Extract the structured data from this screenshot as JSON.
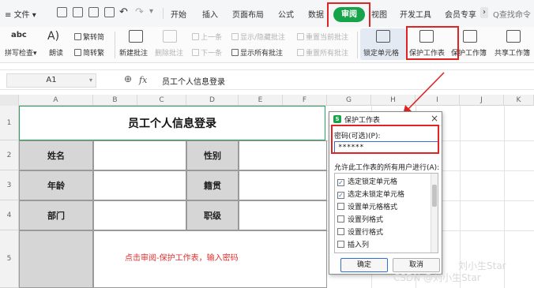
{
  "menu": {
    "file_label": "文件",
    "tabs": [
      "开始",
      "插入",
      "页面布局",
      "公式",
      "数据",
      "审阅",
      "视图",
      "开发工具",
      "会员专享"
    ],
    "active_tab": "审阅",
    "more_glyph": "›",
    "search_label": "Q查找命令"
  },
  "ribbon": {
    "spellcheck": "拼写检查",
    "spellcheck_icon_text": "abc",
    "read_aloud": "朗读",
    "trad_to_simp": "繁转简",
    "simp_to_trad": "简转繁",
    "new_comment": "新建批注",
    "delete_comment": "删除批注",
    "prev_comment": "上一条",
    "next_comment": "下一条",
    "show_hide_comment": "显示/隐藏批注",
    "show_all_comments": "显示所有批注",
    "reset_current_comment": "重置当前批注",
    "reset_all_comments": "重置所有批注",
    "lock_cells": "锁定单元格",
    "protect_sheet": "保护工作表",
    "protect_workbook": "保护工作簿",
    "share_workbook": "共享工作簿"
  },
  "formula_bar": {
    "cell_ref": "A1",
    "fx_label": "fx",
    "content": "员工个人信息登录"
  },
  "grid": {
    "columns": [
      "A",
      "B",
      "C",
      "D",
      "E",
      "F",
      "G",
      "H",
      "I",
      "J",
      "K"
    ],
    "rows": [
      "1",
      "2",
      "3",
      "4",
      "5"
    ]
  },
  "sheet": {
    "title": "员工个人信息登录",
    "name_label": "姓名",
    "gender_label": "性别",
    "age_label": "年龄",
    "native_label": "籍贯",
    "dept_label": "部门",
    "position_label": "职级",
    "note": "点击审阅-保护工作表，输入密码"
  },
  "dialog": {
    "title": "保护工作表",
    "close_glyph": "×",
    "app_icon_letter": "S",
    "password_label": "密码(可选)(P):",
    "password_value": "******",
    "allow_label": "允许此工作表的所有用户进行(A):",
    "permissions": [
      {
        "label": "选定锁定单元格",
        "checked": true
      },
      {
        "label": "选定未锁定单元格",
        "checked": true
      },
      {
        "label": "设置单元格格式",
        "checked": false
      },
      {
        "label": "设置列格式",
        "checked": false
      },
      {
        "label": "设置行格式",
        "checked": false
      },
      {
        "label": "插入列",
        "checked": false
      }
    ],
    "ok_label": "确定",
    "cancel_label": "取消"
  },
  "watermark": {
    "line1": "刘小生Star",
    "line2": "CSDN @刘小生Star"
  },
  "colors": {
    "accent_green": "#17a34a",
    "highlight_red": "#e02424",
    "note_red": "#e03030"
  }
}
